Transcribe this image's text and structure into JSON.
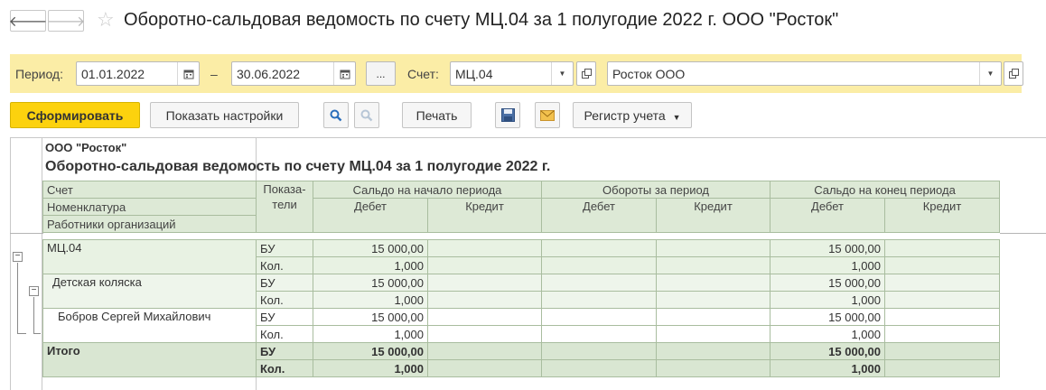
{
  "window": {
    "title": "Оборотно-сальдовая ведомость по счету МЦ.04 за 1 полугодие 2022 г. ООО \"Росток\""
  },
  "params": {
    "period_label": "Период:",
    "date_from": "01.01.2022",
    "dash": "–",
    "date_to": "30.06.2022",
    "ellipsis": "...",
    "account_label": "Счет:",
    "account": "МЦ.04",
    "organization": "Росток ООО"
  },
  "toolbar": {
    "generate": "Сформировать",
    "show_settings": "Показать настройки",
    "print": "Печать",
    "register": "Регистр учета"
  },
  "report": {
    "org": "ООО \"Росток\"",
    "title": "Оборотно-сальдовая ведомость по счету МЦ.04 за 1 полугодие 2022 г.",
    "headers": {
      "account": "Счет",
      "nomenclature": "Номенклатура",
      "employees": "Работники организаций",
      "indicators": "Показа-\nтели",
      "opening": "Сальдо на начало периода",
      "turnover": "Обороты за период",
      "closing": "Сальдо на конец периода",
      "debit": "Дебет",
      "credit": "Кредит"
    },
    "rows": [
      {
        "name": "МЦ.04",
        "ind1": "БУ",
        "ind2": "Кол.",
        "open_d1": "15 000,00",
        "open_d2": "1,000",
        "close_d1": "15 000,00",
        "close_d2": "1,000"
      },
      {
        "name": "Детская коляска",
        "ind1": "БУ",
        "ind2": "Кол.",
        "open_d1": "15 000,00",
        "open_d2": "1,000",
        "close_d1": "15 000,00",
        "close_d2": "1,000"
      },
      {
        "name": "Бобров Сергей Михайлович",
        "ind1": "БУ",
        "ind2": "Кол.",
        "open_d1": "15 000,00",
        "open_d2": "1,000",
        "close_d1": "15 000,00",
        "close_d2": "1,000"
      }
    ],
    "total": {
      "name": "Итого",
      "ind1": "БУ",
      "ind2": "Кол.",
      "open_d1": "15 000,00",
      "open_d2": "1,000",
      "close_d1": "15 000,00",
      "close_d2": "1,000"
    }
  },
  "colors": {
    "params_bg": "#fbeda6",
    "primary_button": "#fcd20e",
    "header_bg": "#dde9d6"
  }
}
